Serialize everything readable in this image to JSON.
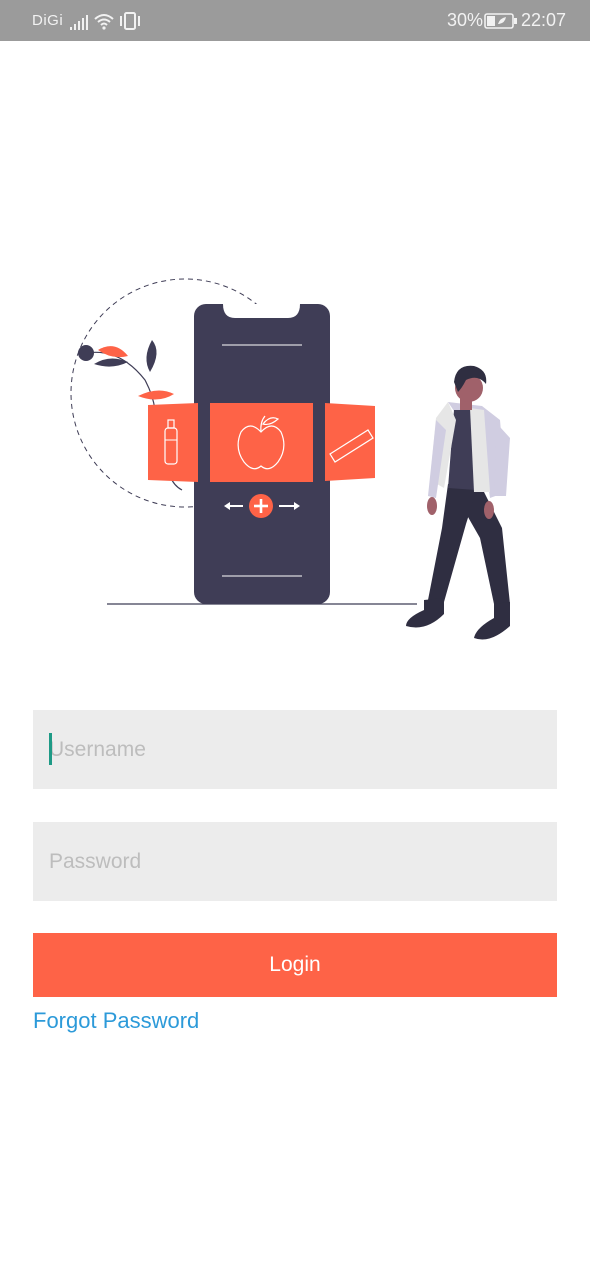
{
  "status_bar": {
    "carrier": "DiGi",
    "battery_percent": "30%",
    "time": "22:07",
    "icons": [
      "signal-icon",
      "wifi-icon",
      "vibrate-icon",
      "battery-icon"
    ]
  },
  "illustration": {
    "name": "phone-and-person-illustration"
  },
  "form": {
    "username_placeholder": "Username",
    "password_placeholder": "Password",
    "login_label": "Login",
    "forgot_password_label": "Forgot Password"
  },
  "colors": {
    "accent": "#fe6347",
    "link": "#2c9ad9",
    "field_background": "#ececec",
    "phone_body": "#3f3d56",
    "status_bar": "#9b9b9b",
    "cursor": "#1e9a86"
  }
}
